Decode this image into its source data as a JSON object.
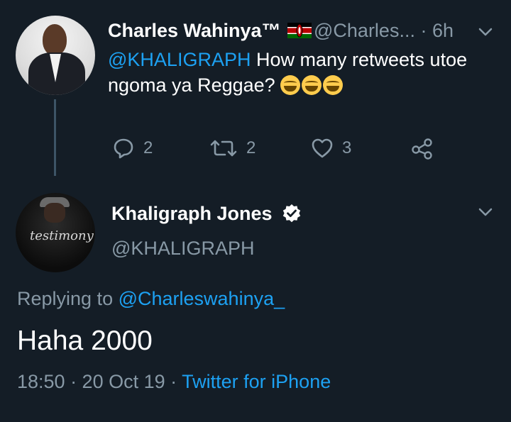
{
  "tweet1": {
    "name": "Charles Wahinya™",
    "handle_time": "@Charles... · 6h",
    "mention": "@KHALIGRAPH",
    "text": " How many retweets utoe ngoma ya Reggae? ",
    "emoji": [
      "face-with-tears-of-joy",
      "face-with-tears-of-joy",
      "face-with-tears-of-joy"
    ],
    "replies": "2",
    "retweets": "2",
    "likes": "3"
  },
  "tweet2": {
    "name": "Khaligraph Jones",
    "handle": "@KHALIGRAPH",
    "avatar_text": "testimony",
    "replying_prefix": "Replying to ",
    "replying_to": "@Charleswahinya_",
    "text": "Haha 2000",
    "time": "18:50 · 20 Oct 19 · ",
    "source": "Twitter for iPhone"
  },
  "colors": {
    "background": "#141d26",
    "secondary": "#8899a6",
    "accent": "#1da1f2"
  }
}
